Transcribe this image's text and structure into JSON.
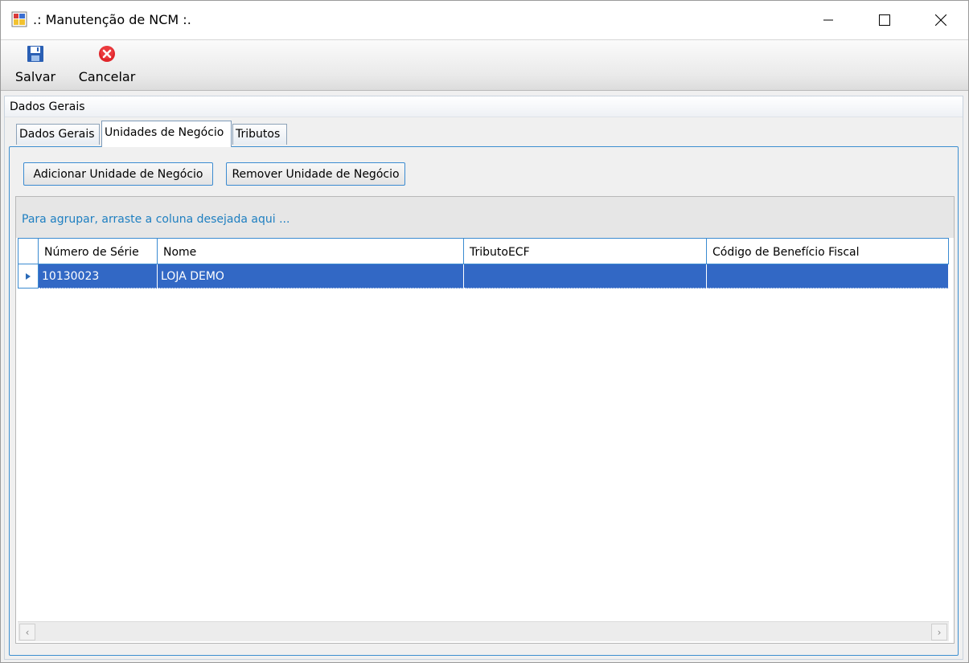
{
  "window": {
    "title": ".: Manutenção de NCM :."
  },
  "toolbar": {
    "save_label": "Salvar",
    "cancel_label": "Cancelar"
  },
  "group": {
    "title": "Dados Gerais"
  },
  "tabs": [
    {
      "label": "Dados Gerais",
      "active": false
    },
    {
      "label": "Unidades de Negócio",
      "active": true
    },
    {
      "label": "Tributos",
      "active": false
    }
  ],
  "actions": {
    "add_label": "Adicionar Unidade de Negócio",
    "remove_label": "Remover Unidade de Negócio"
  },
  "grid": {
    "group_hint": "Para agrupar, arraste a coluna desejada aqui ...",
    "columns": [
      "Número de Série",
      "Nome",
      "TributoECF",
      "Código de Benefício Fiscal"
    ],
    "rows": [
      [
        "10130023",
        "LOJA DEMO",
        "",
        ""
      ]
    ]
  },
  "colors": {
    "selection": "#3268c5",
    "accent": "#3b8bd1",
    "hint_text": "#1e7fc1"
  },
  "icons": {
    "app": "app-icon",
    "save": "floppy-disk-icon",
    "cancel": "cancel-circle-icon"
  }
}
